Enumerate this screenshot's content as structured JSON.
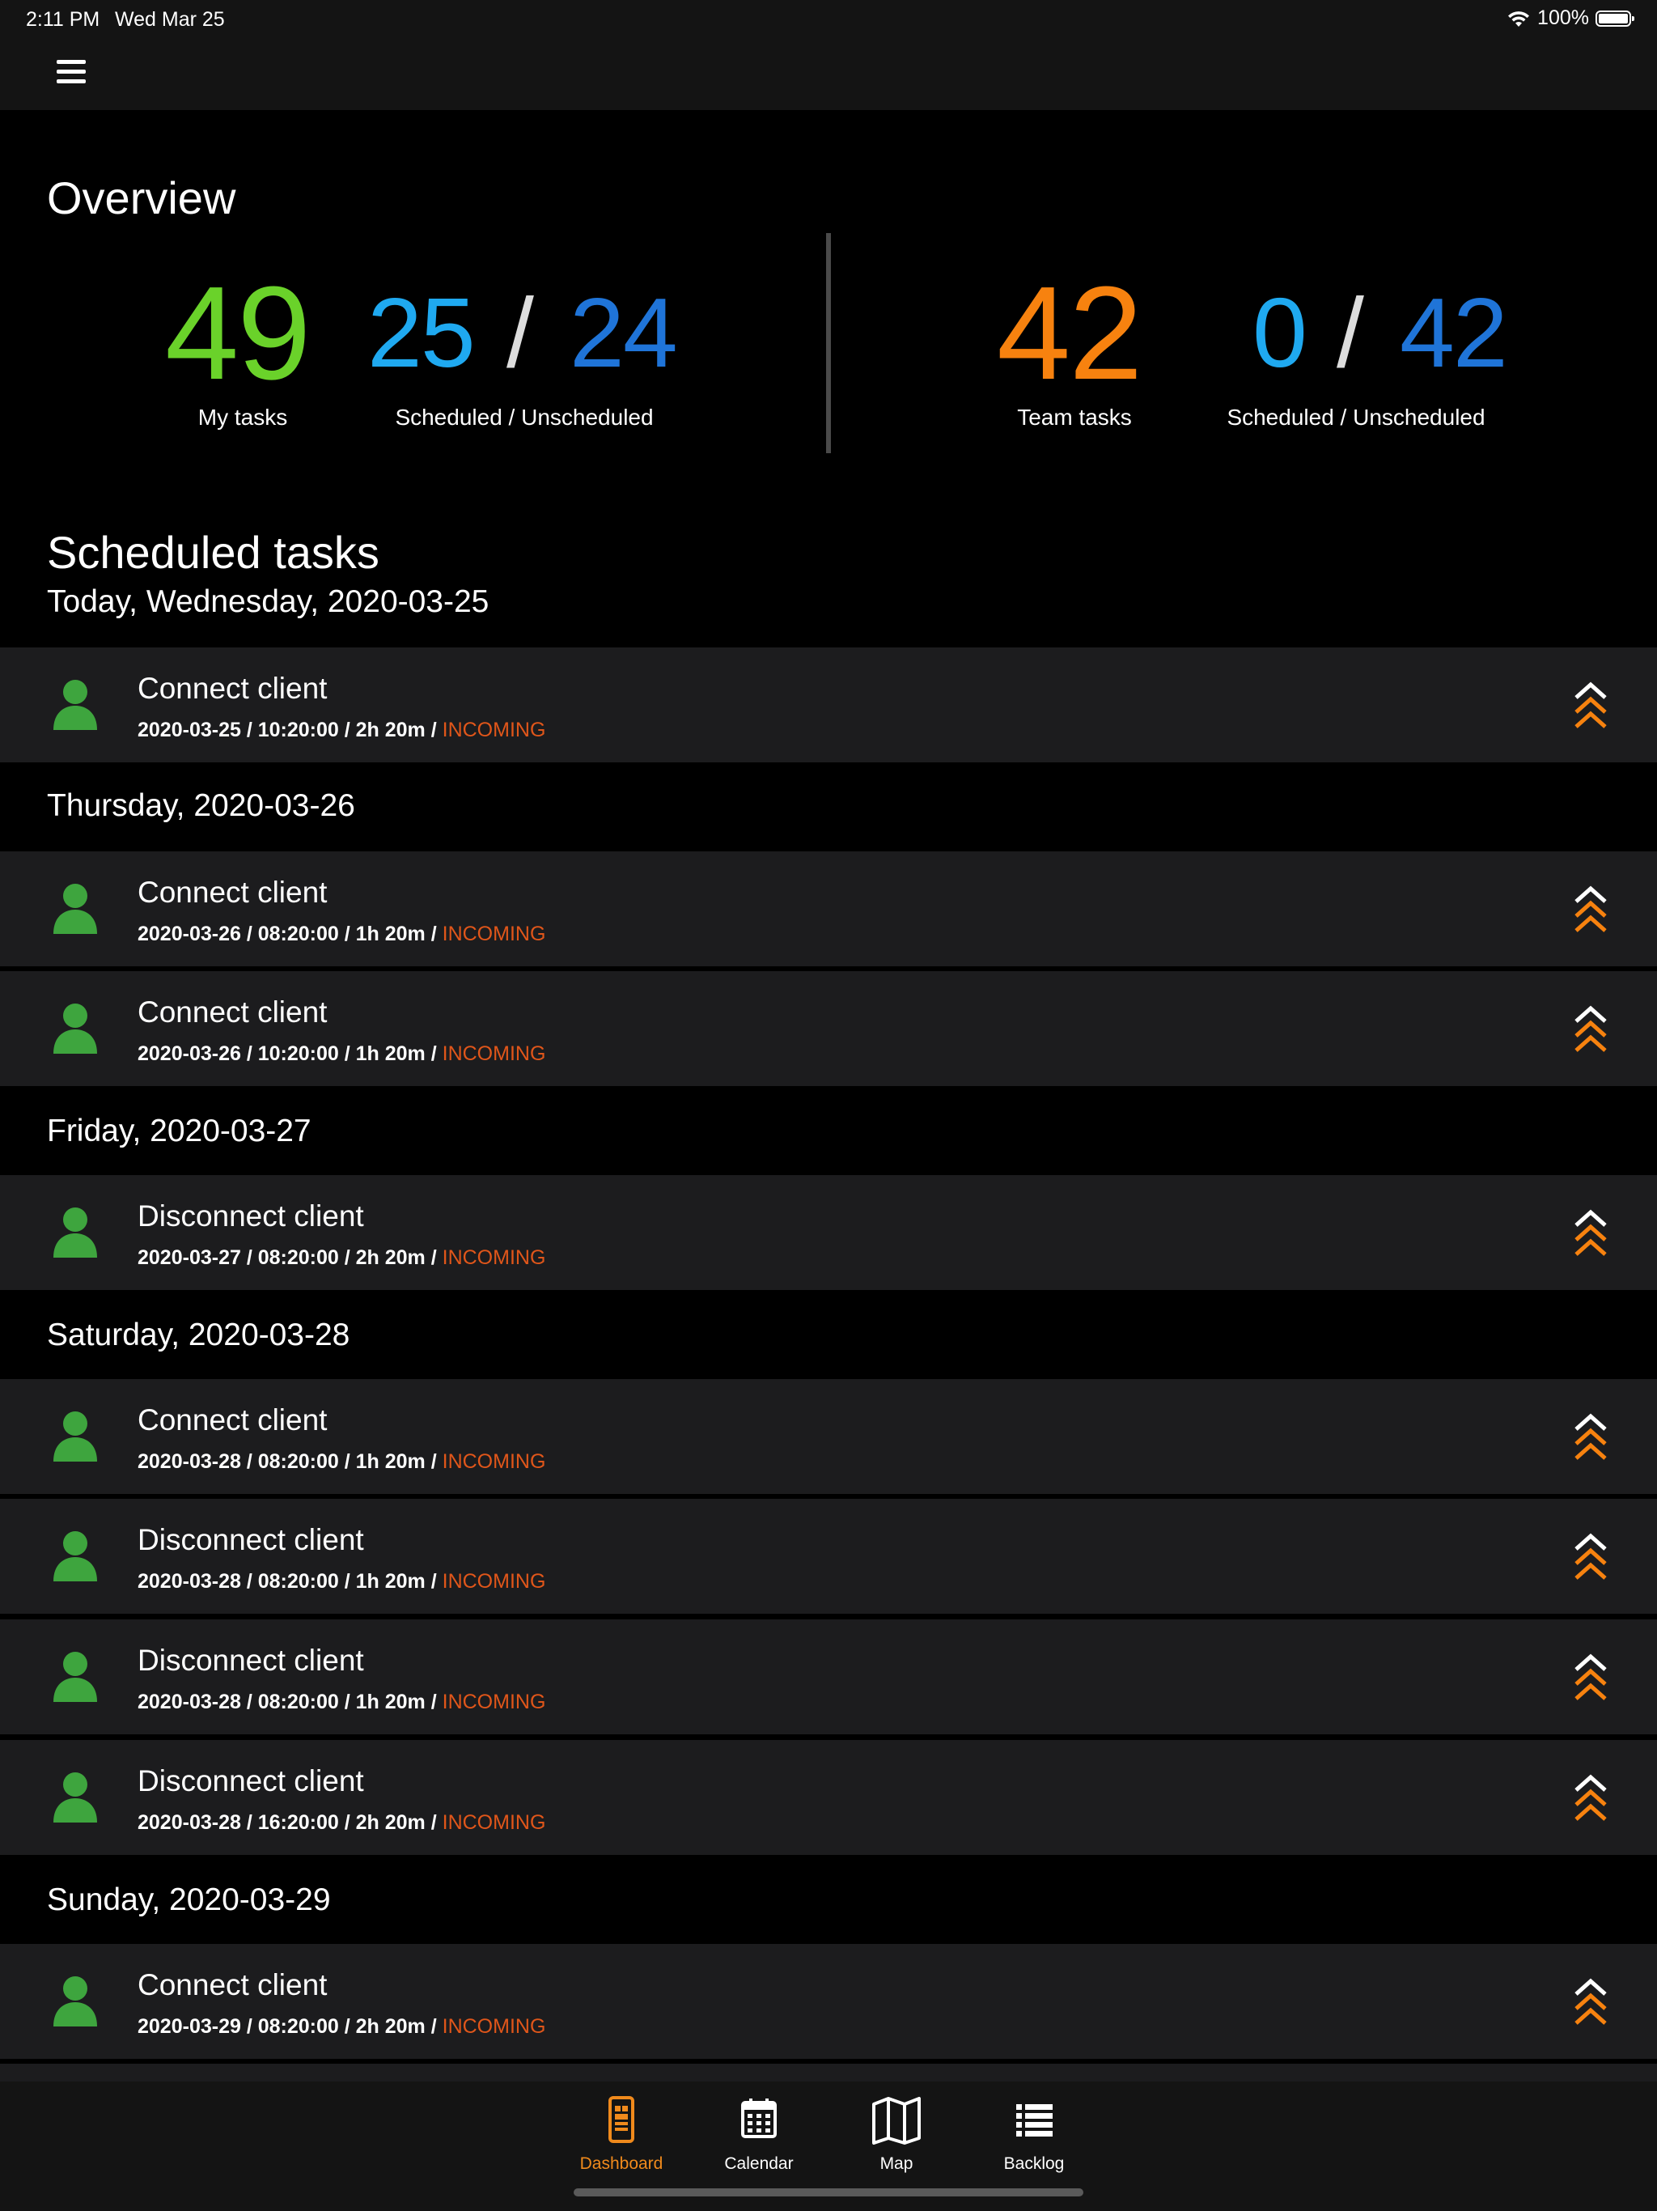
{
  "status_bar": {
    "time": "2:11 PM",
    "date": "Wed Mar 25",
    "battery": "100%"
  },
  "overview": {
    "title": "Overview",
    "my_tasks": {
      "count": "49",
      "label": "My tasks",
      "color": "#6ad22a"
    },
    "my_split": {
      "scheduled": "25",
      "separator": "/",
      "unscheduled": "24",
      "label": "Scheduled / Unscheduled"
    },
    "team_tasks": {
      "count": "42",
      "label": "Team tasks",
      "color": "#f7820f"
    },
    "team_split": {
      "scheduled": "0",
      "separator": "/",
      "unscheduled": "42",
      "label": "Scheduled / Unscheduled"
    },
    "scheduled_color": "#1fa9f0",
    "unscheduled_color": "#1f74d8"
  },
  "scheduled": {
    "title": "Scheduled tasks",
    "days": [
      "Today, Wednesday, 2020-03-25",
      "Thursday, 2020-03-26",
      "Friday, 2020-03-27",
      "Saturday, 2020-03-28",
      "Sunday, 2020-03-29"
    ],
    "tasks": [
      {
        "title": "Connect client",
        "meta": "2020-03-25 / 10:20:00 / 2h 20m / ",
        "status": "INCOMING"
      },
      {
        "title": "Connect client",
        "meta": "2020-03-26 / 08:20:00 / 1h 20m / ",
        "status": "INCOMING"
      },
      {
        "title": "Connect client",
        "meta": "2020-03-26 / 10:20:00 / 1h 20m / ",
        "status": "INCOMING"
      },
      {
        "title": "Disconnect client",
        "meta": "2020-03-27 / 08:20:00 / 2h 20m / ",
        "status": "INCOMING"
      },
      {
        "title": "Connect client",
        "meta": "2020-03-28 / 08:20:00 / 1h 20m / ",
        "status": "INCOMING"
      },
      {
        "title": "Disconnect client",
        "meta": "2020-03-28 / 08:20:00 / 1h 20m / ",
        "status": "INCOMING"
      },
      {
        "title": "Disconnect client",
        "meta": "2020-03-28 / 08:20:00 / 1h 20m / ",
        "status": "INCOMING"
      },
      {
        "title": "Disconnect client",
        "meta": "2020-03-28 / 16:20:00 / 2h 20m / ",
        "status": "INCOMING"
      },
      {
        "title": "Connect client",
        "meta": "2020-03-29 / 08:20:00 / 2h 20m / ",
        "status": "INCOMING"
      }
    ]
  },
  "tab_bar": {
    "tabs": [
      {
        "label": "Dashboard",
        "icon": "dashboard-icon",
        "active": true
      },
      {
        "label": "Calendar",
        "icon": "calendar-icon"
      },
      {
        "label": "Map",
        "icon": "map-icon"
      },
      {
        "label": "Backlog",
        "icon": "list-icon"
      }
    ],
    "active_color": "#f08a1c"
  },
  "colors": {
    "avatar": "#3ea53e",
    "priority_top": "#ffffff",
    "priority_bottom": "#f7820f",
    "row_bg": "#1c1c1e"
  }
}
